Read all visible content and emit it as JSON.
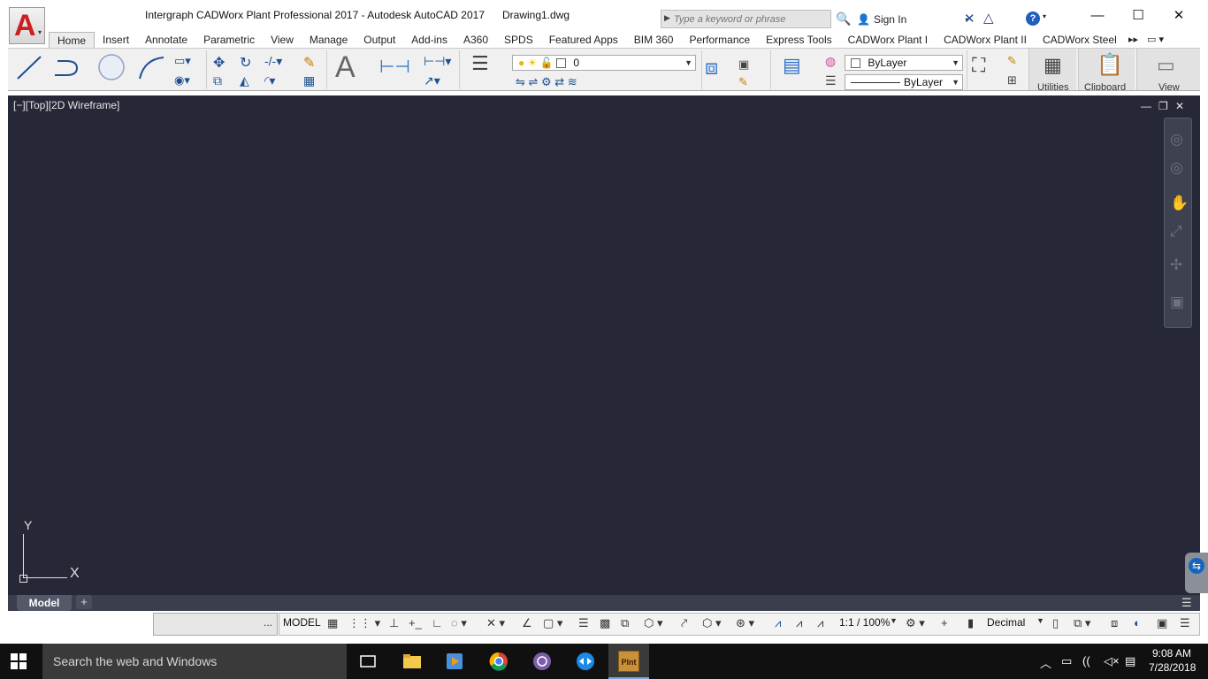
{
  "title_bar": {
    "window_title": "Intergraph CADWorx Plant Professional 2017 - Autodesk AutoCAD 2017      Drawing1.dwg",
    "search_placeholder": "Type a keyword or phrase",
    "sign_in_label": "Sign In",
    "help_symbol": "?",
    "app_letter": "A"
  },
  "ribbon_tabs": [
    "Home",
    "Insert",
    "Annotate",
    "Parametric",
    "View",
    "Manage",
    "Output",
    "Add-ins",
    "A360",
    "SPDS",
    "Featured Apps",
    "BIM 360",
    "Performance",
    "Express Tools",
    "CADWorx Plant I",
    "CADWorx Plant II",
    "CADWorx Steel"
  ],
  "active_tab": "Home",
  "ribbon": {
    "text_button_glyph": "A",
    "layer_value": "0",
    "color_value": "ByLayer",
    "linetype_value": "ByLayer",
    "groups": [
      "Utilities",
      "Clipboard",
      "View"
    ]
  },
  "viewport": {
    "label": "[−][Top][2D Wireframe]",
    "ucs_x": "X",
    "ucs_y": "Y"
  },
  "layout_tabs": {
    "model_tab": "Model",
    "add_tab": "+"
  },
  "status_bar": {
    "command_dots": "...",
    "space": "MODEL",
    "scale": "1:1 / 100%",
    "units": "Decimal"
  },
  "taskbar": {
    "search_placeholder": "Search the web and Windows",
    "time": "9:08 AM",
    "date": "7/28/2018",
    "plnt_label": "Plnt"
  },
  "colors": {
    "canvas": "#262837",
    "accent_blue": "#1d4f91",
    "autocad_red": "#cc1f1f",
    "taskbar": "#101010"
  }
}
